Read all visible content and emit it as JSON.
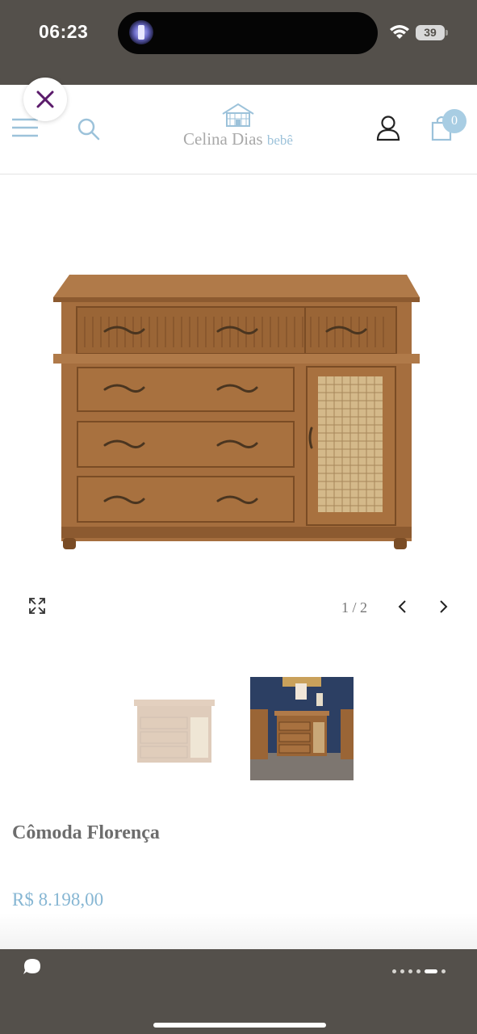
{
  "status_bar": {
    "time": "06:23",
    "battery": "39"
  },
  "header": {
    "brand_name": "Celina Dias",
    "brand_sub": "bebê",
    "cart_count": "0",
    "icons": [
      "close-icon",
      "menu-icon",
      "search-icon",
      "user-icon",
      "shopping-bag-icon"
    ]
  },
  "gallery": {
    "counter": "1 / 2",
    "thumbnails": [
      "chest-of-drawers-white-background",
      "chest-of-drawers-in-nursery"
    ]
  },
  "product": {
    "title": "Cômoda Florença",
    "price": "R$ 8.198,00"
  },
  "colors": {
    "status_bar": "#54504b",
    "accent_blue": "#86b6d3",
    "wood": "#a36c3c",
    "close_x": "#5b1b6b"
  }
}
